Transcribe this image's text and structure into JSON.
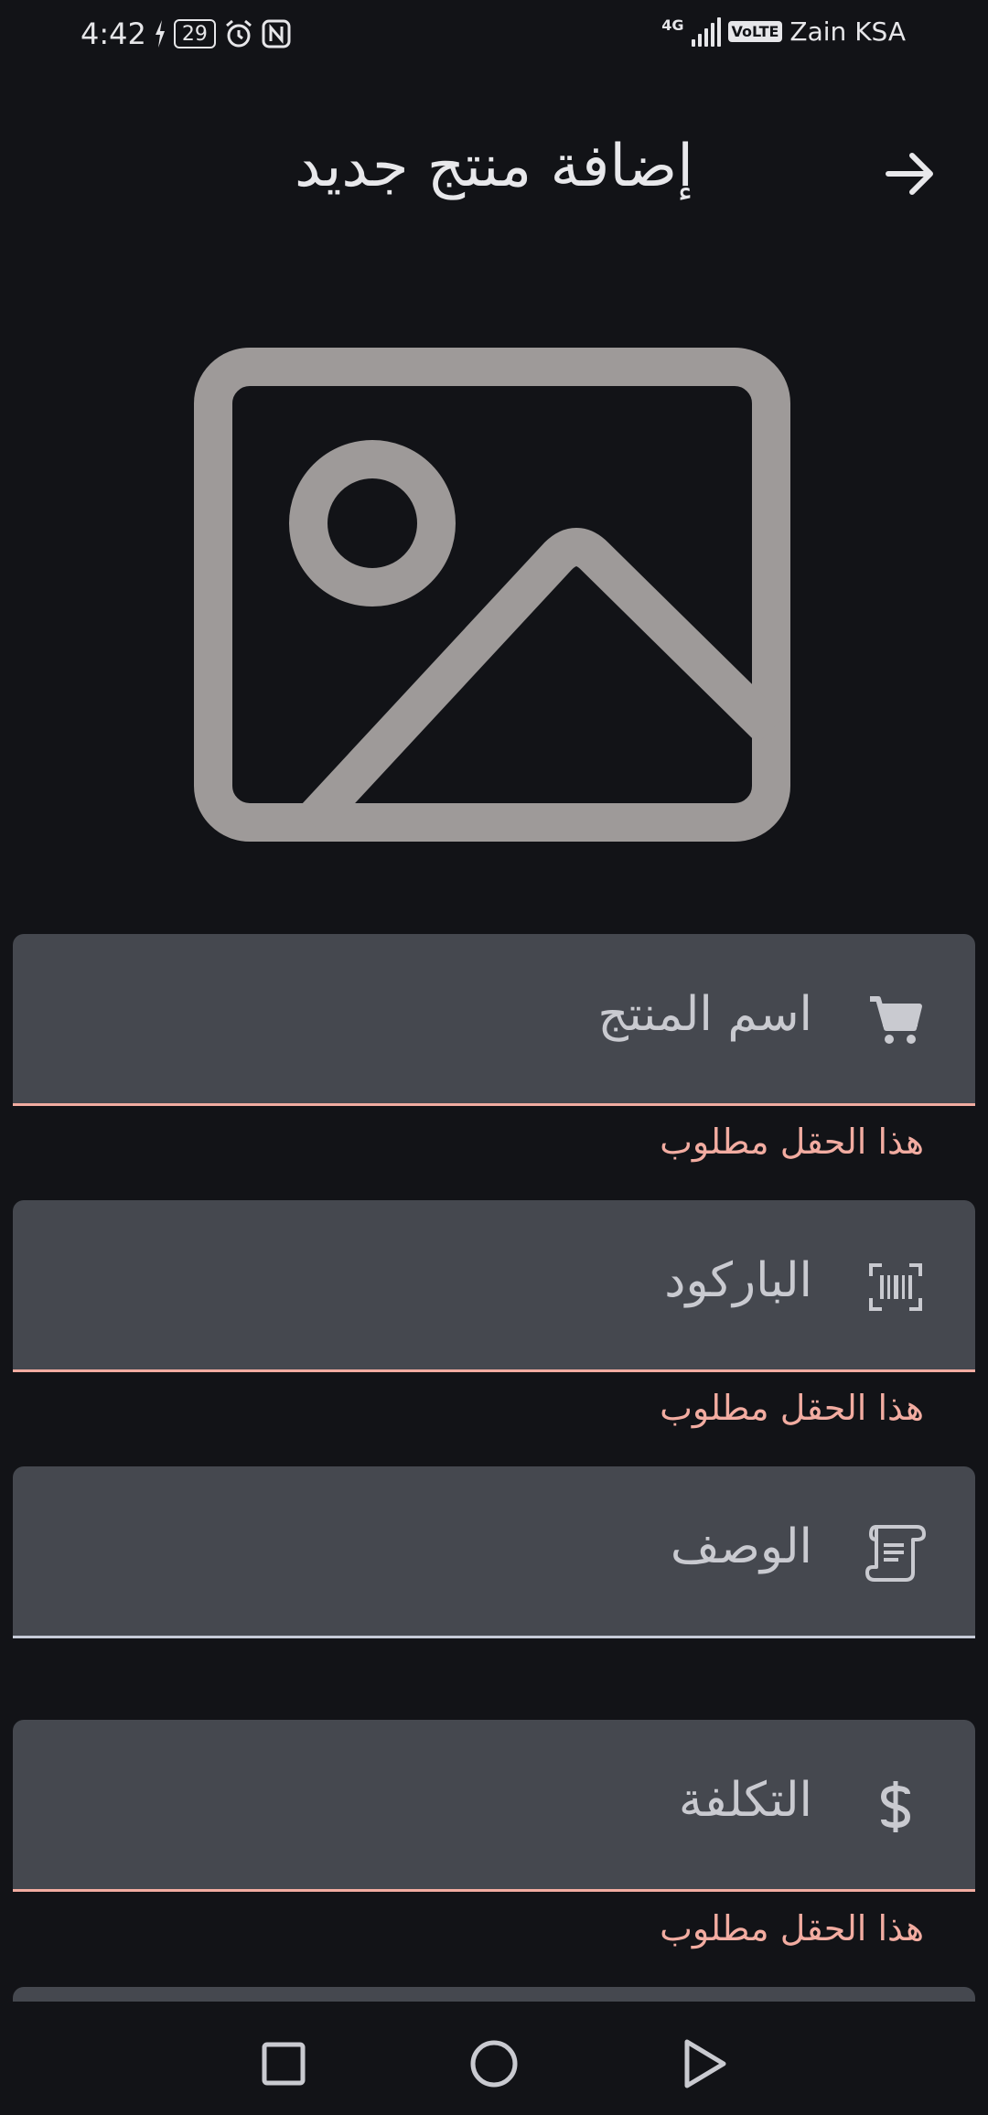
{
  "status_bar": {
    "time": "4:42",
    "battery": "29",
    "network": "4G",
    "volte": "VoLTE",
    "carrier": "Zain KSA"
  },
  "header": {
    "title": "إضافة منتج جديد",
    "back_icon": "arrow-right-icon"
  },
  "image_placeholder": {
    "icon": "image-placeholder-icon"
  },
  "form": {
    "fields": [
      {
        "label": "اسم المنتج",
        "icon": "cart-icon",
        "error": "هذا الحقل مطلوب",
        "underline_color": "#f2aca1"
      },
      {
        "label": "الباركود",
        "icon": "barcode-icon",
        "error": "هذا الحقل مطلوب",
        "underline_color": "#f2aca1"
      },
      {
        "label": "الوصف",
        "icon": "description-icon",
        "error": "",
        "underline_color": "#c6cbd8"
      },
      {
        "label": "التكلفة",
        "icon": "dollar-icon",
        "error": "هذا الحقل مطلوب",
        "underline_color": "#f2aca1"
      }
    ]
  },
  "colors": {
    "background": "#121317",
    "field_background": "#45484f",
    "error": "#f2aca1",
    "placeholder_icon": "#9e9a99"
  },
  "nav_bar": {
    "recents_icon": "square-icon",
    "home_icon": "circle-icon",
    "back_icon": "triangle-back-icon"
  }
}
